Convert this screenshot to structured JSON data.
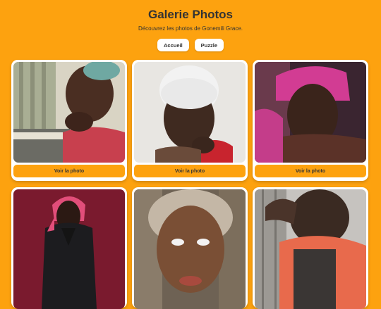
{
  "header": {
    "title": "Galerie Photos",
    "subtitle": "Découvrez les photos de Gonemili Grace."
  },
  "nav": {
    "home_label": "Accueil",
    "puzzle_label": "Puzzle"
  },
  "colors": {
    "background": "#fda20f",
    "card": "#ffffff",
    "button": "#fda20f"
  },
  "gallery": {
    "view_label": "Voir la photo",
    "photos": [
      {
        "alt": "photo-1"
      },
      {
        "alt": "photo-2"
      },
      {
        "alt": "photo-3"
      },
      {
        "alt": "photo-4"
      },
      {
        "alt": "photo-5"
      },
      {
        "alt": "photo-6"
      }
    ]
  }
}
